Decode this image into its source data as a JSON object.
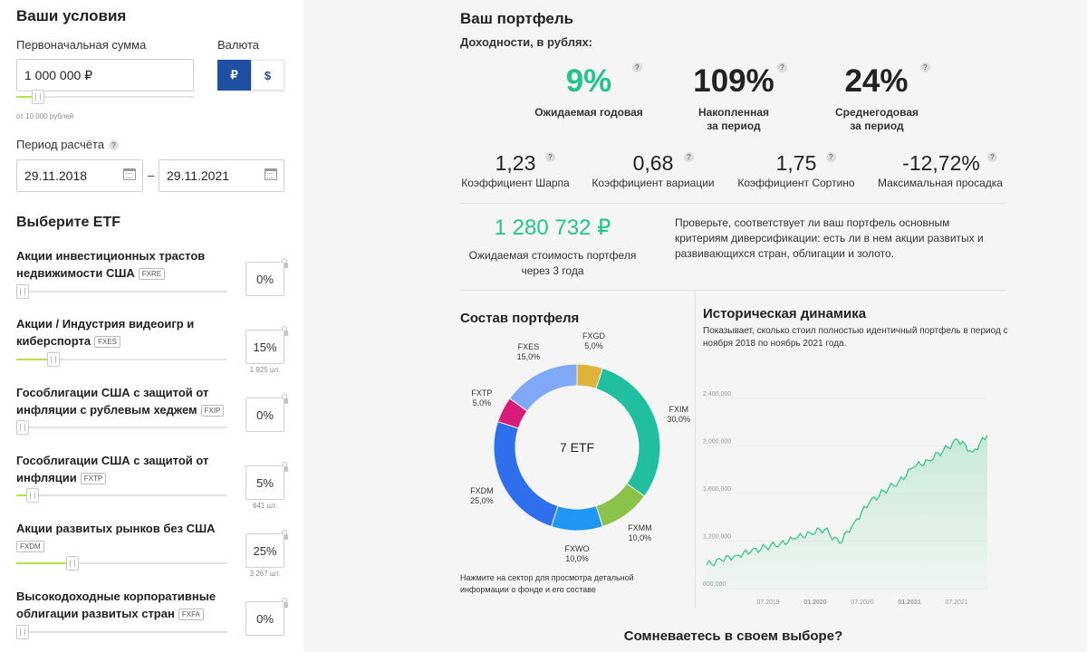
{
  "conditions": {
    "title": "Ваши условия",
    "initial_label": "Первоначальная сумма",
    "initial_value": "1 000 000 ₽",
    "initial_min": "от 10 000 рублей",
    "currency_label": "Валюта",
    "currency_rub": "₽",
    "currency_usd": "$",
    "period_label": "Период расчёта",
    "period_help": "?",
    "date_from": "29.11.2018",
    "date_sep": "–",
    "date_to": "29.11.2021",
    "etf_title": "Выберите ETF"
  },
  "etfs": [
    {
      "name": "Акции инвестиционных трастов недвижимости США",
      "ticker": "FXRE",
      "percent": "0%",
      "shares": "",
      "fraction": 0.0
    },
    {
      "name": "Акции / Индустрия видеоигр и киберспорта",
      "ticker": "FXES",
      "percent": "15%",
      "shares": "1 925 шт.",
      "fraction": 0.15
    },
    {
      "name": "Гособлигации США с защитой от инфляции с рублевым хеджем",
      "ticker": "FXIP",
      "percent": "0%",
      "shares": "",
      "fraction": 0.0
    },
    {
      "name": "Гособлигации США с защитой от инфляции",
      "ticker": "FXTP",
      "percent": "5%",
      "shares": "641 шт.",
      "fraction": 0.05
    },
    {
      "name": "Акции развитых рынков без США",
      "ticker": "FXDM",
      "percent": "25%",
      "shares": "3 267 шт.",
      "fraction": 0.25
    },
    {
      "name": "Высокодоходные корпоративные облигации развитых стран",
      "ticker": "FXFA",
      "percent": "0%",
      "shares": "",
      "fraction": 0.0
    }
  ],
  "portfolio": {
    "title": "Ваш портфель",
    "subtitle": "Доходности, в рублях:",
    "help": "?",
    "expected_annual_value": "9%",
    "expected_annual_label": "Ожидаемая годовая",
    "cumulative_value": "109%",
    "cumulative_label_1": "Накопленная",
    "cumulative_label_2": "за период",
    "avg_annual_value": "24%",
    "avg_annual_label_1": "Среднегодовая",
    "avg_annual_label_2": "за период",
    "sharpe_value": "1,23",
    "sharpe_label": "Коэффициент Шарпа",
    "variation_value": "0,68",
    "variation_label": "Коэффициент вариации",
    "sortino_value": "1,75",
    "sortino_label": "Коэффициент Сортино",
    "drawdown_value": "-12,72%",
    "drawdown_label": "Максимальная просадка",
    "expected_value": "1 280 732 ₽",
    "expected_value_label_1": "Ожидаемая стоимость портфеля",
    "expected_value_label_2": "через 3 года",
    "note": "Проверьте, соответствует ли ваш портфель основным критериям диверсификации: есть ли в нем акции развитых и развивающихся стран, облигации и золото."
  },
  "composition": {
    "title": "Состав портфеля",
    "center": "7 ETF",
    "hint": "Нажмите на сектор для просмотра детальной информации о фонде и его составе",
    "colors": {
      "FXGD": "#e0b43c",
      "FXIM": "#1fbf9f",
      "FXMM": "#8bc34a",
      "FXWO": "#2196f3",
      "FXDM": "#2f6fee",
      "FXTP": "#d81b7a",
      "FXES": "#7fa8f5"
    }
  },
  "chart_data": [
    {
      "type": "pie",
      "categories": [
        "FXGD",
        "FXIM",
        "FXMM",
        "FXWO",
        "FXDM",
        "FXTP",
        "FXES"
      ],
      "values": [
        5.0,
        30.0,
        10.0,
        10.0,
        25.0,
        5.0,
        15.0
      ],
      "value_labels": [
        "5,0%",
        "30,0%",
        "10,0%",
        "10,0%",
        "25,0%",
        "5,0%",
        "15,0%"
      ],
      "title": "Состав портфеля"
    },
    {
      "type": "line",
      "title": "Историческая динамика",
      "subtitle": "Показывает, сколько стоил полностью идентичный портфель в период с ноября 2018 по ноябрь 2021 года.",
      "y_ticks": [
        "2,400,000",
        "2,000,000",
        "1,600,000",
        "1,200,000",
        "800,000"
      ],
      "x_ticks": [
        "07.2019",
        "01.2020",
        "07.2020",
        "01.2021",
        "07.2021"
      ],
      "x": [
        "11.2018",
        "01.2019",
        "03.2019",
        "05.2019",
        "07.2019",
        "09.2019",
        "11.2019",
        "01.2020",
        "02.2020",
        "03.2020",
        "05.2020",
        "07.2020",
        "09.2020",
        "11.2020",
        "01.2021",
        "03.2021",
        "05.2021",
        "07.2021",
        "09.2021",
        "11.2021"
      ],
      "values": [
        1000000,
        1040000,
        1080000,
        1110000,
        1150000,
        1180000,
        1220000,
        1270000,
        1300000,
        1180000,
        1360000,
        1520000,
        1620000,
        1700000,
        1820000,
        1880000,
        1960000,
        2050000,
        1950000,
        2090000
      ],
      "ylim": [
        800000,
        2400000
      ],
      "line_color": "#25c47c"
    }
  ],
  "bottom_question": "Сомневаетесь в своем выборе?"
}
